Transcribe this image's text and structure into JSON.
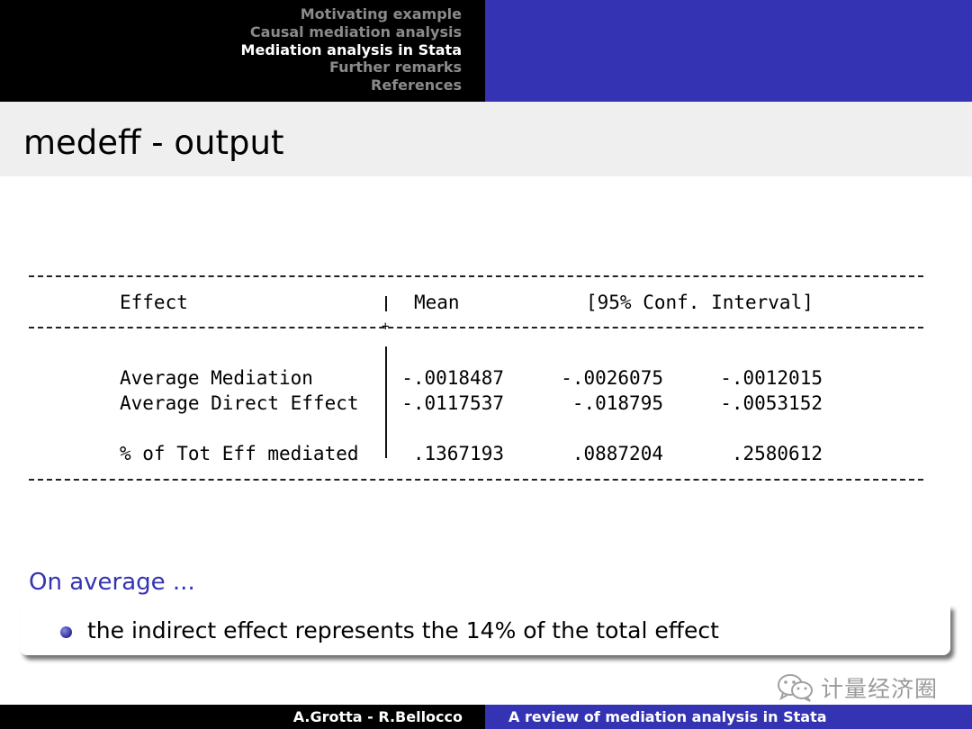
{
  "nav": {
    "items": [
      "Motivating example",
      "Causal mediation analysis",
      "Mediation analysis in Stata",
      "Further remarks",
      "References"
    ],
    "active_index": 2
  },
  "frame": {
    "title": "medeff - output"
  },
  "stata_output": {
    "headers": {
      "effect": "Effect",
      "mean": "Mean",
      "interval": "[95% Conf. Interval]"
    },
    "rows": [
      {
        "label": "Average Mediation",
        "mean": "-.0018487",
        "lower": "-.0026075",
        "upper": "-.0012015"
      },
      {
        "label": "Average Direct Effect",
        "mean": "-.0117537",
        "lower": "-.018795",
        "upper": "-.0053152"
      },
      {
        "label": "% of Tot Eff mediated",
        "mean": ".1367193",
        "lower": ".0887204",
        "upper": ".2580612"
      }
    ]
  },
  "block": {
    "title": "On average ...",
    "bullet": "the indirect effect represents the 14% of the total effect"
  },
  "watermark": {
    "text": "计量经济圈",
    "icon": "wechat-icon"
  },
  "footer": {
    "authors": "A.Grotta - R.Bellocco",
    "title": "A review of mediation analysis in Stata"
  },
  "colors": {
    "accent": "#3333b3",
    "header_dark": "#000000",
    "title_bar": "#efefef",
    "nav_inactive": "#8a8a8a"
  }
}
